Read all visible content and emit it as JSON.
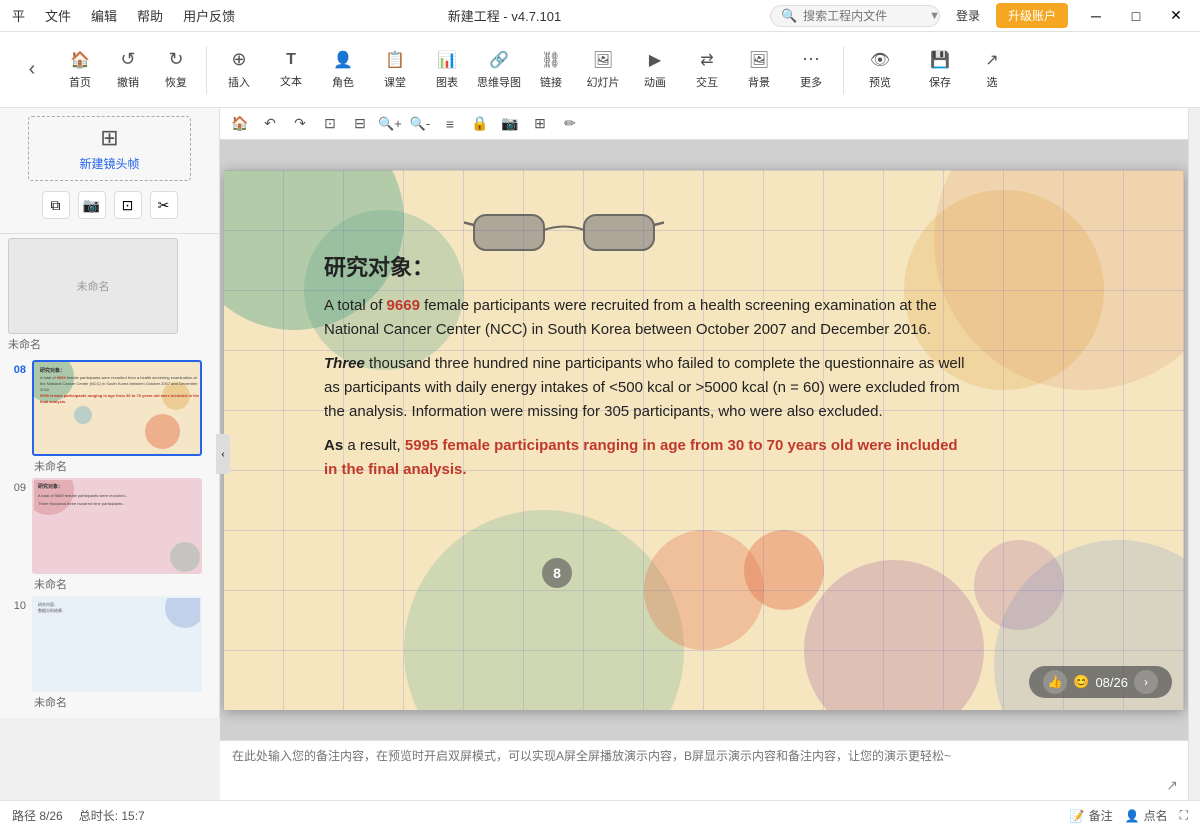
{
  "titlebar": {
    "menu_items": [
      "平",
      "文件",
      "编辑",
      "帮助",
      "用户反馈"
    ],
    "title": "新建工程 - v4.7.101",
    "search_placeholder": "搜索工程内文件",
    "login": "登录",
    "upgrade": "升级账户",
    "win_min": "─",
    "win_max": "□",
    "win_close": "✕"
  },
  "toolbar": {
    "nav_back": "‹",
    "nav_forward": "›",
    "items": [
      {
        "label": "首页",
        "icon": "🏠"
      },
      {
        "label": "撤销",
        "icon": "↺"
      },
      {
        "label": "恢复",
        "icon": "↻"
      },
      {
        "label": "插入",
        "icon": "⊕"
      },
      {
        "label": "文本",
        "icon": "T"
      },
      {
        "label": "角色",
        "icon": "👤"
      },
      {
        "label": "课堂",
        "icon": "📋"
      },
      {
        "label": "图表",
        "icon": "📊"
      },
      {
        "label": "思维导图",
        "icon": "🔗"
      },
      {
        "label": "链接",
        "icon": "🔗"
      },
      {
        "label": "幻灯片",
        "icon": "🖼"
      },
      {
        "label": "动画",
        "icon": "▶"
      },
      {
        "label": "交互",
        "icon": "🔀"
      },
      {
        "label": "背景",
        "icon": "🖼"
      },
      {
        "label": "更多",
        "icon": "…"
      },
      {
        "label": "预览",
        "icon": "👁"
      },
      {
        "label": "保存",
        "icon": "💾"
      },
      {
        "label": "选",
        "icon": "↗"
      }
    ]
  },
  "sidebar": {
    "new_frame_label": "新建镜头帧",
    "action_copy": "复制帧",
    "action_photo": "📷",
    "action_resize": "⊡",
    "action_crop": "✂",
    "slides": [
      {
        "number": "08",
        "label": "未命名",
        "active": true
      },
      {
        "number": "09",
        "label": "未命名",
        "active": false
      },
      {
        "number": "10",
        "label": "未命名",
        "active": false
      }
    ]
  },
  "slide": {
    "number_label": "08/26",
    "title": "研究对象：",
    "para1_prefix": "A total of ",
    "para1_highlight": "9669",
    "para1_rest": " female participants were recruited from a health screening examination at the National Cancer Center (NCC) in South Korea between October 2007 and December 2016.",
    "para2_bold": " Three",
    "para2_rest": " thousand three hundred nine participants who failed to complete the questionnaire as well as participants with daily energy intakes of <500 kcal or >5000 kcal (n = 60) were excluded from the analysis. Information were missing for 305 participants, who were also excluded.",
    "para3_prefix": "As",
    "para3_rest": " a result, ",
    "para3_highlight": "5995 female participants ranging in age from 30 to 70 years old were included in the final analysis.",
    "circle_number": "8"
  },
  "content_toolbar": {
    "icons": [
      "🏠",
      "↶",
      "↷",
      "⊡",
      "⊟",
      "🔍+",
      "🔍-",
      "≡",
      "🔒",
      "📷",
      "⊞",
      "✏"
    ]
  },
  "notes": {
    "placeholder": "在此处输入您的备注内容，在预览时开启双屏模式，可以实现A屏全屏播放演示内容，B屏显示演示内容和备注内容，让您的演示更轻松~"
  },
  "statusbar": {
    "path": "路径 8/26",
    "total": "总时长: 15:7",
    "annotate": "备注",
    "roll_call": "点名",
    "fullscreen": "⛶"
  }
}
